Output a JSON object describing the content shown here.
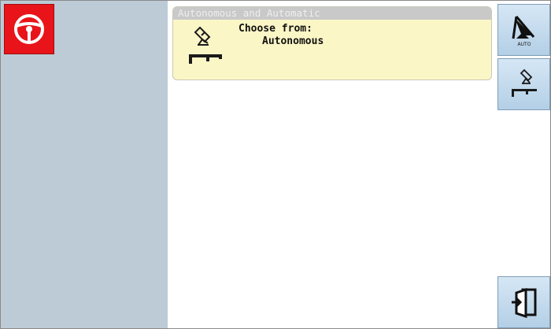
{
  "panel": {
    "title": "Autonomous and Automatic",
    "prompt": "Choose from:",
    "option": "Autonomous"
  },
  "buttons": {
    "auto_icon_text": "AUTO"
  },
  "colors": {
    "left_panel": "#bccbd5",
    "steer_button": "#e8141a",
    "panel_bg": "#fbf6c6",
    "panel_header": "#c9c9c9",
    "button_gradient_top": "#d6e7f5",
    "button_gradient_bottom": "#b3cfe6"
  },
  "icons": {
    "steer": "steering-wheel-icon",
    "auto": "auto-steer-arrow-icon",
    "autonomous": "satellite-implement-icon",
    "exit": "exit-icon"
  }
}
